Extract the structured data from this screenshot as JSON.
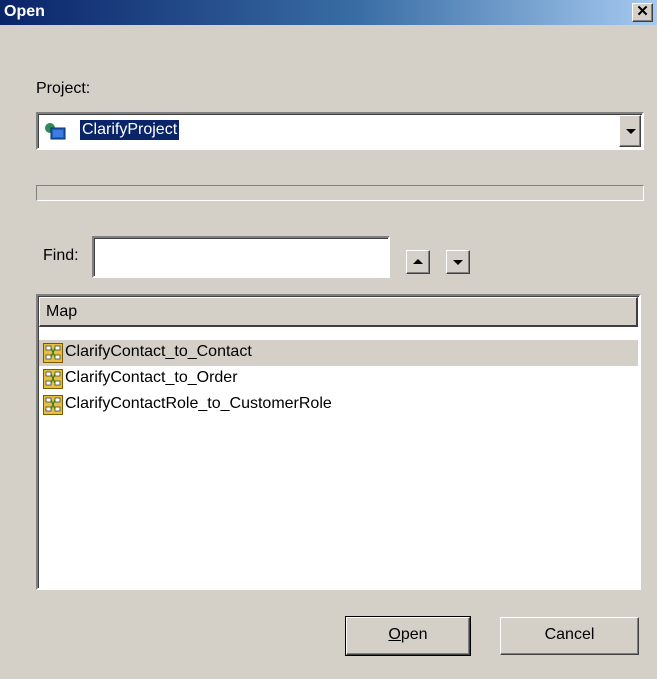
{
  "window": {
    "title": "Open",
    "close_glyph": "✕"
  },
  "project": {
    "label": "Project:",
    "selected": "ClarifyProject",
    "icon": "project-icon"
  },
  "find": {
    "label": "Find:",
    "value": "",
    "up_icon": "arrow-up-icon",
    "down_icon": "arrow-down-icon"
  },
  "list": {
    "column_header": "Map",
    "items": [
      {
        "label": "ClarifyContact_to_Contact",
        "icon": "map-icon",
        "selected": true
      },
      {
        "label": "ClarifyContact_to_Order",
        "icon": "map-icon",
        "selected": false
      },
      {
        "label": "ClarifyContactRole_to_CustomerRole",
        "icon": "map-icon",
        "selected": false
      }
    ]
  },
  "buttons": {
    "open_mnemonic": "O",
    "open_rest": "pen",
    "cancel": "Cancel"
  },
  "colors": {
    "titlebar_start": "#0a246a",
    "titlebar_end": "#a6caf0",
    "dialog_bg": "#d4d0c8",
    "selection_bg": "#0a246a"
  }
}
